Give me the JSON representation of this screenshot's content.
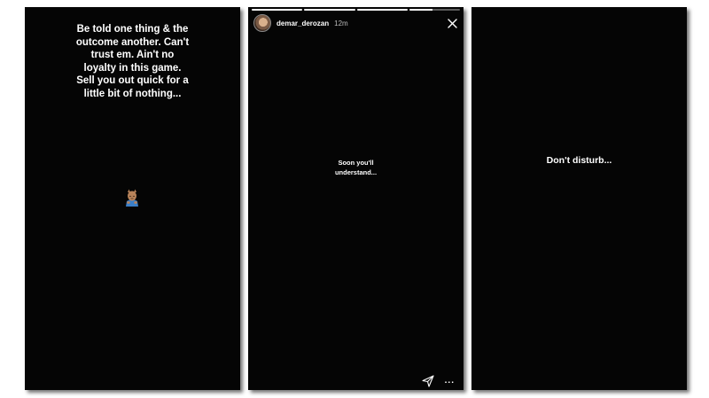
{
  "panels": [
    {
      "text": "Be told one thing & the\noutcome another. Can't\ntrust em. Ain't no\nloyalty in this game.\nSell you out quick for a\nlittle bit of nothing...",
      "emoji": "person-bowing-emoji"
    },
    {
      "story": {
        "username": "demar_derozan",
        "timestamp": "12m",
        "progress_segments": [
          1,
          1,
          1,
          0.45
        ],
        "close_icon": "close-icon",
        "send_icon": "send-icon",
        "more_label": "..."
      },
      "text": "Soon you'll\nunderstand..."
    },
    {
      "text": "Don't disturb..."
    }
  ],
  "colors": {
    "panel_bg": "#050505",
    "text": "#ffffff",
    "timestamp": "#bdbdbd"
  }
}
